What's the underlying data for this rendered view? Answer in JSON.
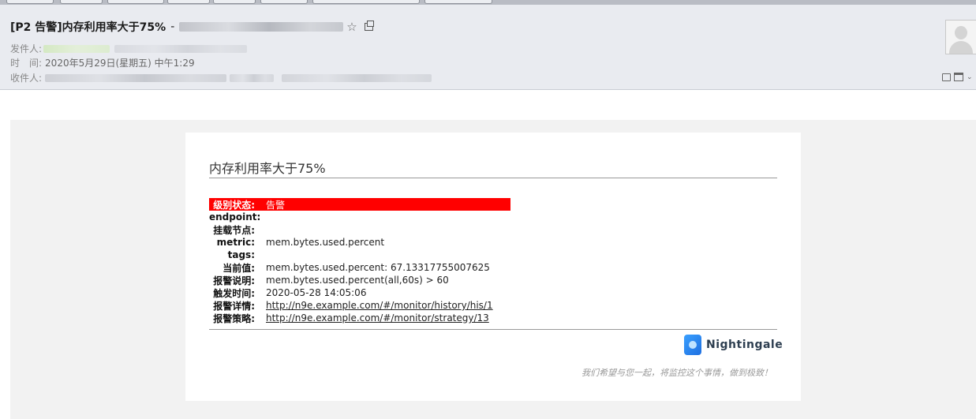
{
  "toolbar_buttons": [
    "",
    "",
    "",
    "",
    "",
    "",
    "",
    ""
  ],
  "header": {
    "subject": "[P2 告警]内存利用率大于75%",
    "subject_dash": "-",
    "sender_label": "发件人:",
    "time_label": "时　间:",
    "time_value": "2020年5月29日(星期五) 中午1:29",
    "recipient_label": "收件人:"
  },
  "icons": {
    "star": "star-icon",
    "popout": "popout-window-icon",
    "avatar": "avatar-icon",
    "note": "note-icon",
    "print": "print-icon",
    "more": "chevron-down-icon"
  },
  "alert": {
    "title": "内存利用率大于75%",
    "rows": [
      {
        "key": "级别状态:",
        "value": "告警",
        "highlight": true
      },
      {
        "key": "endpoint:",
        "value": ""
      },
      {
        "key": "挂载节点:",
        "value": ""
      },
      {
        "key": "metric:",
        "value": "mem.bytes.used.percent"
      },
      {
        "key": "tags:",
        "value": ""
      },
      {
        "key": "当前值:",
        "value": "mem.bytes.used.percent: 67.13317755007625"
      },
      {
        "key": "报警说明:",
        "value": "mem.bytes.used.percent(all,60s) > 60"
      },
      {
        "key": "触发时间:",
        "value": "2020-05-28 14:05:06"
      },
      {
        "key": "报警详情:",
        "value": "http://n9e.example.com/#/monitor/history/his/1",
        "link": true
      },
      {
        "key": "报警策略:",
        "value": "http://n9e.example.com/#/monitor/strategy/13",
        "link": true
      }
    ]
  },
  "footer": {
    "logo_text": "Nightingale",
    "slogan": "我们希望与您一起，将监控这个事情，做到极致！"
  },
  "colors": {
    "highlight_row": "#ff0000",
    "header_bg": "#e9ebf0",
    "body_bg": "#f2f2f2"
  }
}
